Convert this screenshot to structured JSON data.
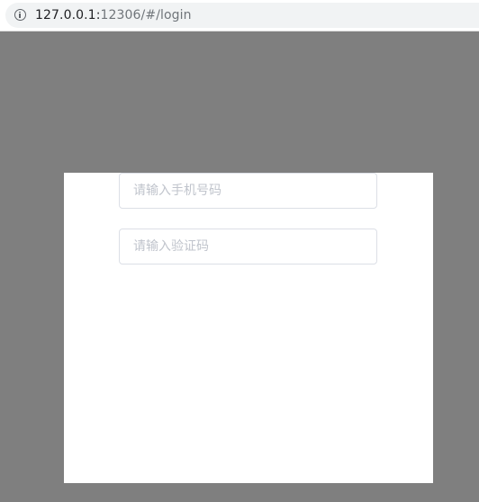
{
  "browser": {
    "url_host": "127.0.0.1:",
    "url_rest": "12306/#/login"
  },
  "login": {
    "phone_placeholder": "请输入手机号码",
    "code_placeholder": "请输入验证码"
  }
}
